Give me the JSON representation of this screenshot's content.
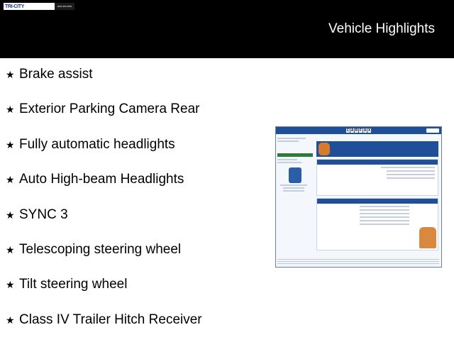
{
  "dealer_logo": {
    "text": "TRI-CITY",
    "phone": "(555) 555-5555"
  },
  "header": {
    "title": "Vehicle Highlights"
  },
  "highlights": [
    "Brake assist",
    "Exterior Parking Camera Rear",
    "Fully automatic headlights",
    "Auto High-beam Headlights",
    "SYNC 3",
    "Telescoping steering wheel",
    "Tilt steering wheel",
    "Class IV Trailer Hitch Receiver"
  ],
  "carfax": {
    "logo_letters": [
      "C",
      "A",
      "R",
      "F",
      "A",
      "X"
    ],
    "banner_text": "CARFAX HAS THE MOST ACCIDENT & DAMAGE INFORMATION"
  },
  "colors": {
    "header_bg": "#000000",
    "carfax_blue": "#1f4f99"
  }
}
